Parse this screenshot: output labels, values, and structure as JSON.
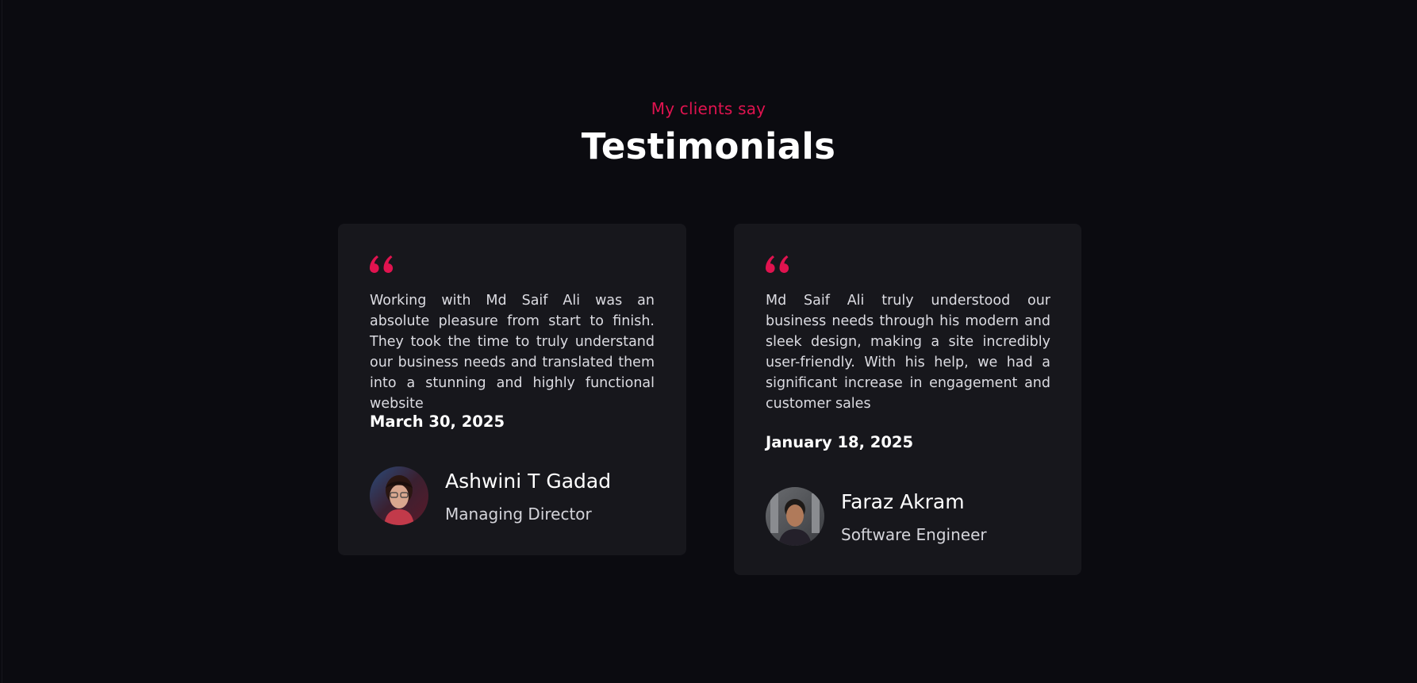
{
  "section": {
    "eyebrow": "My clients say",
    "title": "Testimonials"
  },
  "colors": {
    "background": "#0b0b10",
    "card": "#17171c",
    "accent": "#e0134f",
    "text": "#ffffff"
  },
  "testimonials": [
    {
      "quote_icon": "quote-icon",
      "text": "Working with Md Saif Ali was an absolute pleasure from start to finish. They took the time to truly understand our business needs and translated them into a stunning and highly functional website",
      "date": "March 30, 2025",
      "name": "Ashwini T Gadad",
      "role": "Managing Director"
    },
    {
      "quote_icon": "quote-icon",
      "text": "Md Saif Ali truly understood our business needs through his modern and sleek design, making a site incredibly user-friendly. With his help, we had a significant increase in engagement and customer sales",
      "date": "January 18, 2025",
      "name": "Faraz Akram",
      "role": "Software Engineer"
    }
  ]
}
